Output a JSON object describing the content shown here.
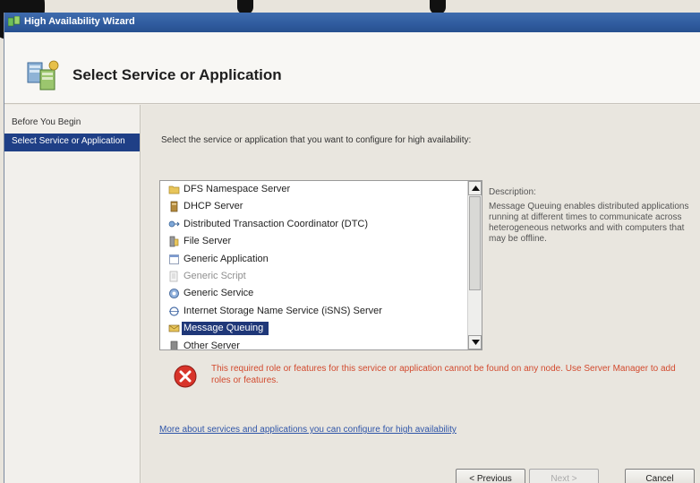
{
  "window": {
    "title": "High Availability Wizard"
  },
  "header": {
    "title": "Select Service or Application"
  },
  "nav": {
    "items": [
      {
        "label": "Before You Begin",
        "active": false
      },
      {
        "label": "Select Service or Application",
        "active": true
      }
    ]
  },
  "main": {
    "instruction": "Select the service or application that you want to configure for high availability:",
    "services": [
      {
        "label": "DFS Namespace Server",
        "icon": "folder-icon"
      },
      {
        "label": "DHCP Server",
        "icon": "server-icon"
      },
      {
        "label": "Distributed Transaction Coordinator (DTC)",
        "icon": "dtc-icon"
      },
      {
        "label": "File Server",
        "icon": "file-server-icon"
      },
      {
        "label": "Generic Application",
        "icon": "application-icon"
      },
      {
        "label": "Generic Script",
        "icon": "script-icon",
        "faint": true
      },
      {
        "label": "Generic Service",
        "icon": "service-icon"
      },
      {
        "label": "Internet Storage Name Service (iSNS) Server",
        "icon": "isns-icon"
      },
      {
        "label": "Message Queuing",
        "icon": "message-queue-icon",
        "selected": true
      },
      {
        "label": "Other Server",
        "icon": "server-icon",
        "partial": true
      }
    ],
    "description": {
      "title": "Description:",
      "text": "Message Queuing enables distributed applications running at different times to communicate across heterogeneous networks and with computers that may be offline."
    },
    "error": "This required role or features for this service or application cannot be found on any node. Use Server Manager to add roles or features.",
    "more_link": "More about services and applications you can configure for high availability"
  },
  "buttons": {
    "previous": "< Previous",
    "next": "Next >",
    "cancel": "Cancel"
  },
  "colors": {
    "titlebar": "#2f5b9e",
    "nav_active": "#1f3f86",
    "selection": "#1f3778",
    "error_text": "#d24a2e",
    "link": "#2f55a8"
  }
}
